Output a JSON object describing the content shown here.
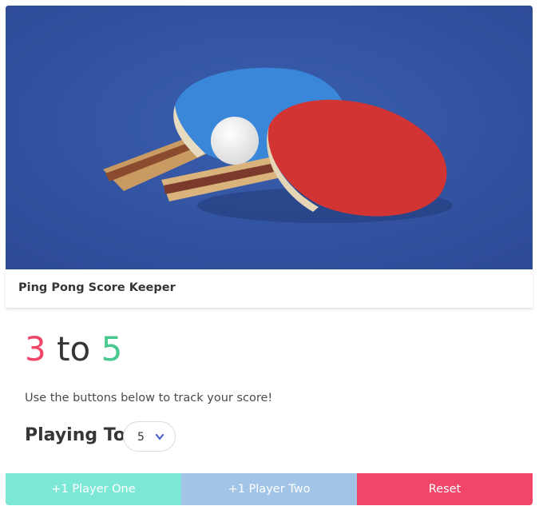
{
  "card": {
    "title": "Ping Pong Score Keeper"
  },
  "score": {
    "player_one": "3",
    "separator": "to",
    "player_two": "5"
  },
  "hint": "Use the buttons below to track your score!",
  "playing_to": {
    "label": "Playing To",
    "selected": "5"
  },
  "buttons": {
    "player_one": "+1 Player One",
    "player_two": "+1 Player Two",
    "reset": "Reset"
  },
  "colors": {
    "player_one": "#f14668",
    "player_two": "#48c78e",
    "button_player_one": "#7ee8d6",
    "button_player_two": "#a2c4e6",
    "button_reset": "#f14668"
  },
  "icons": {
    "select_arrow": "chevron-down-icon"
  }
}
